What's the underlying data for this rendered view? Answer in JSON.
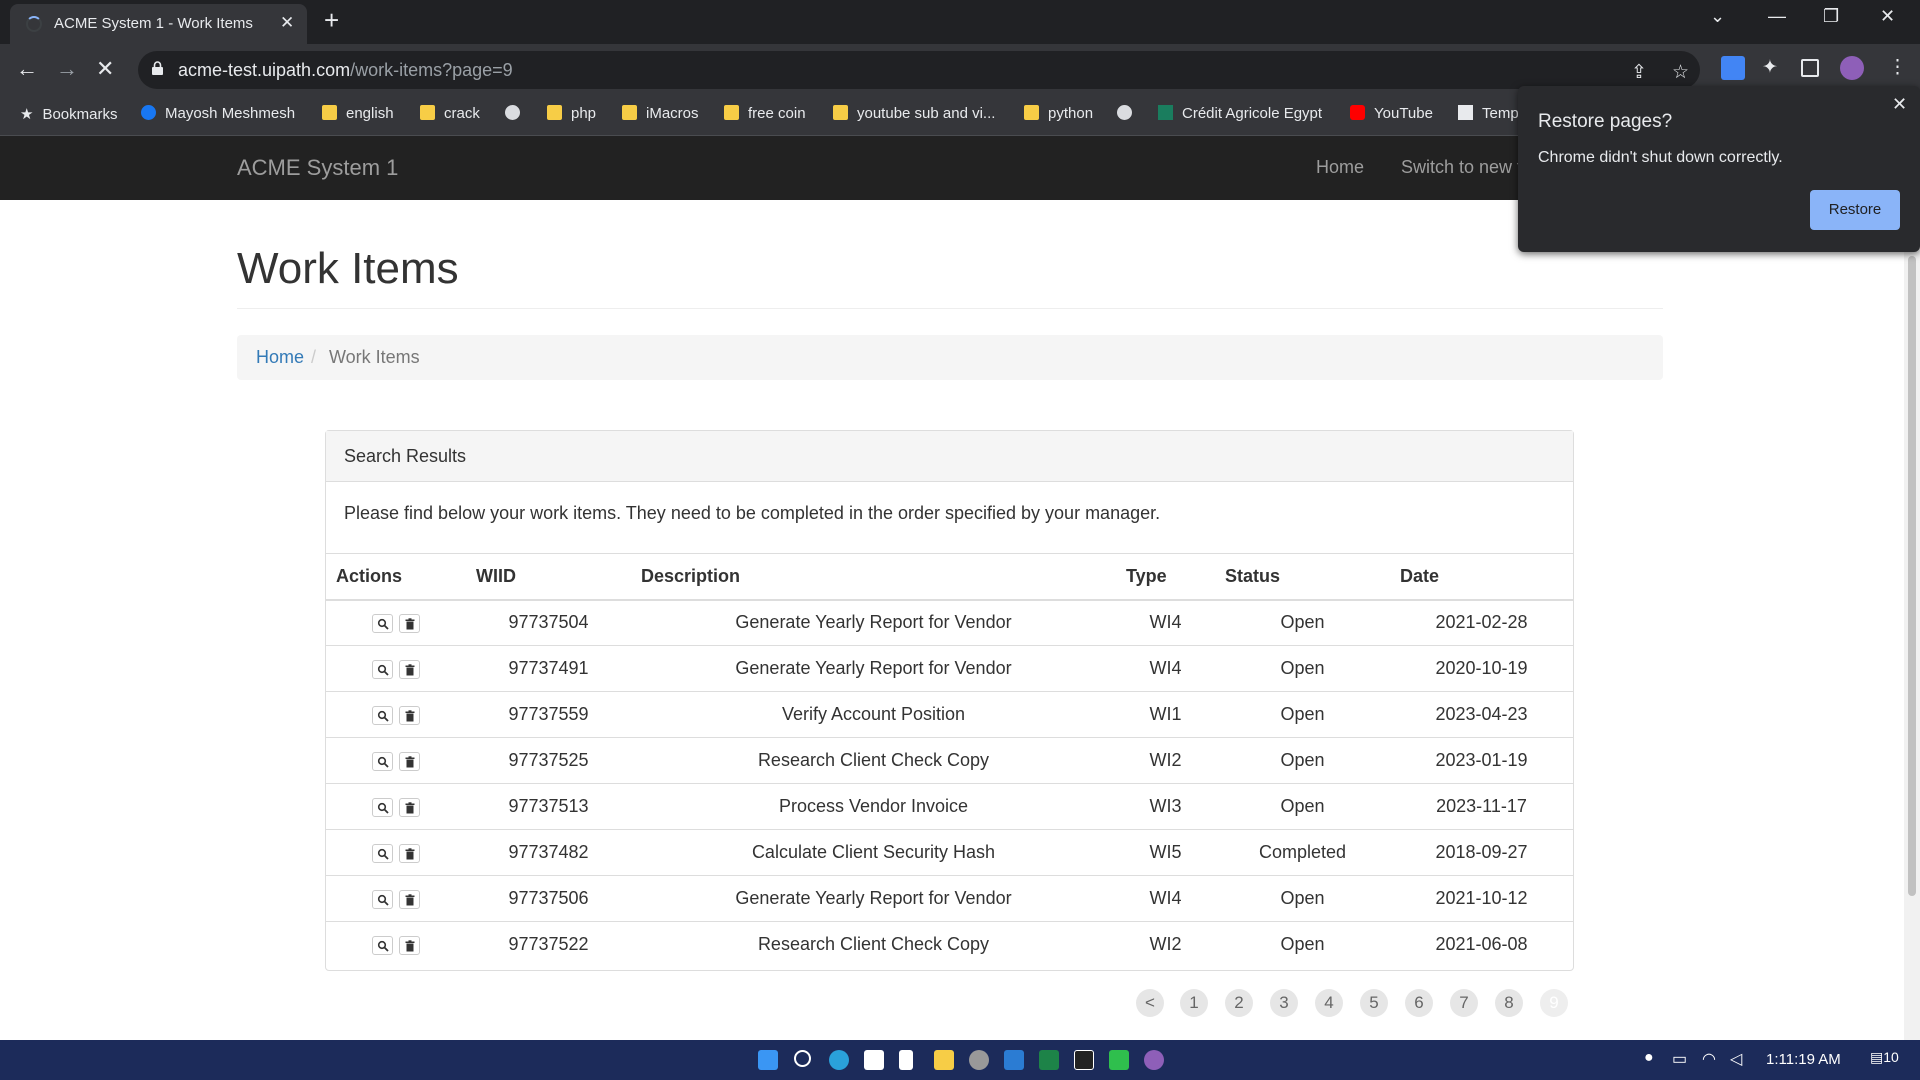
{
  "browser": {
    "tab_title": "ACME System 1 - Work Items",
    "url_host": "acme-test.uipath.com",
    "url_path": "/work-items?page=9",
    "bookmarks": [
      {
        "label": "Bookmarks",
        "icon": "star-icon"
      },
      {
        "label": "Mayosh Meshmesh",
        "icon": "facebook-icon"
      },
      {
        "label": "english",
        "icon": "folder-icon"
      },
      {
        "label": "crack",
        "icon": "folder-icon"
      },
      {
        "label": "",
        "icon": "globe-icon"
      },
      {
        "label": "php",
        "icon": "folder-icon"
      },
      {
        "label": "iMacros",
        "icon": "folder-icon"
      },
      {
        "label": "free coin",
        "icon": "folder-icon"
      },
      {
        "label": "youtube sub and vi...",
        "icon": "folder-icon"
      },
      {
        "label": "python",
        "icon": "folder-icon"
      },
      {
        "label": "",
        "icon": "globe-icon"
      },
      {
        "label": "Crédit Agricole Egypt",
        "icon": "bank-icon"
      },
      {
        "label": "YouTube",
        "icon": "youtube-icon"
      },
      {
        "label": "Temp",
        "icon": "temp-icon"
      }
    ]
  },
  "site": {
    "brand": "ACME System 1",
    "nav": [
      "Home",
      "Switch to new t"
    ]
  },
  "page": {
    "title": "Work Items",
    "breadcrumb": {
      "home": "Home",
      "sep": "/",
      "current": "Work Items"
    },
    "panel_title": "Search Results",
    "panel_text": "Please find below your work items. They need to be completed in the order specified by your manager."
  },
  "table": {
    "headers": [
      "Actions",
      "WIID",
      "Description",
      "Type",
      "Status",
      "Date"
    ],
    "rows": [
      {
        "wiid": "97737504",
        "description": "Generate Yearly Report for Vendor",
        "type": "WI4",
        "status": "Open",
        "date": "2021-02-28"
      },
      {
        "wiid": "97737491",
        "description": "Generate Yearly Report for Vendor",
        "type": "WI4",
        "status": "Open",
        "date": "2020-10-19"
      },
      {
        "wiid": "97737559",
        "description": "Verify Account Position",
        "type": "WI1",
        "status": "Open",
        "date": "2023-04-23"
      },
      {
        "wiid": "97737525",
        "description": "Research Client Check Copy",
        "type": "WI2",
        "status": "Open",
        "date": "2023-01-19"
      },
      {
        "wiid": "97737513",
        "description": "Process Vendor Invoice",
        "type": "WI3",
        "status": "Open",
        "date": "2023-11-17"
      },
      {
        "wiid": "97737482",
        "description": "Calculate Client Security Hash",
        "type": "WI5",
        "status": "Completed",
        "date": "2018-09-27"
      },
      {
        "wiid": "97737506",
        "description": "Generate Yearly Report for Vendor",
        "type": "WI4",
        "status": "Open",
        "date": "2021-10-12"
      },
      {
        "wiid": "97737522",
        "description": "Research Client Check Copy",
        "type": "WI2",
        "status": "Open",
        "date": "2021-06-08"
      }
    ]
  },
  "pagination": {
    "prev": "<",
    "pages": [
      "1",
      "2",
      "3",
      "4",
      "5",
      "6",
      "7",
      "8",
      "9"
    ],
    "current": "9"
  },
  "popup": {
    "title": "Restore pages?",
    "text": "Chrome didn't shut down correctly.",
    "button": "Restore"
  },
  "taskbar": {
    "time": "1:11:19 AM",
    "notification_count": "10"
  },
  "colors": {
    "navbar": "#222222",
    "link": "#337ab7",
    "restore_button": "#8ab4f8",
    "taskbar": "#1c2b5a"
  }
}
